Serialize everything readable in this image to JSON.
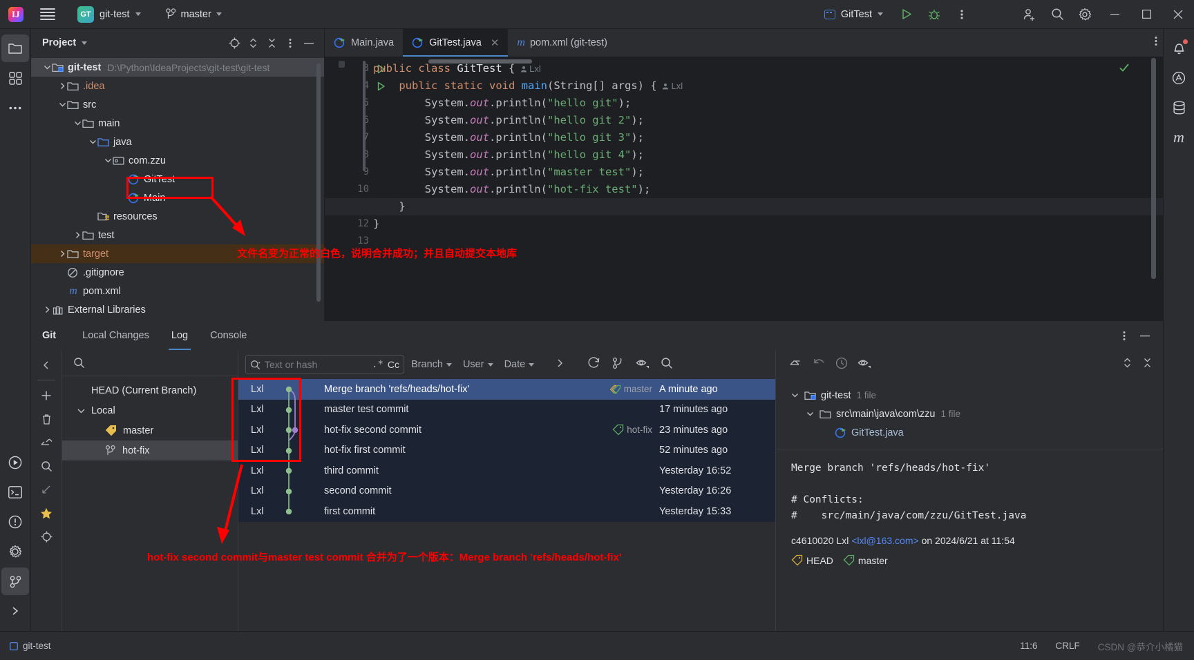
{
  "titlebar": {
    "project_name": "git-test",
    "project_badge": "GT",
    "branch": "master",
    "run_config": "GitTest",
    "icons": [
      "menu-icon",
      "run-icon",
      "debug-icon",
      "more-icon",
      "add-user-icon",
      "search-icon",
      "settings-icon"
    ]
  },
  "project_panel": {
    "title": "Project",
    "tree": [
      {
        "label": "git-test",
        "path": "D:\\Python\\IdeaProjects\\git-test\\git-test",
        "indent": 0,
        "arrow": "down",
        "icon": "module-folder-icon",
        "bold": true,
        "selected": true
      },
      {
        "label": ".idea",
        "indent": 1,
        "arrow": "right",
        "icon": "folder-icon",
        "color": "orange"
      },
      {
        "label": "src",
        "indent": 1,
        "arrow": "down",
        "icon": "folder-icon"
      },
      {
        "label": "main",
        "indent": 2,
        "arrow": "down",
        "icon": "folder-icon"
      },
      {
        "label": "java",
        "indent": 3,
        "arrow": "down",
        "icon": "source-folder-icon"
      },
      {
        "label": "com.zzu",
        "indent": 4,
        "arrow": "down",
        "icon": "package-icon"
      },
      {
        "label": "GitTest",
        "indent": 5,
        "arrow": "none",
        "icon": "java-class-icon",
        "highlighted": true
      },
      {
        "label": "Main",
        "indent": 5,
        "arrow": "none",
        "icon": "java-class-icon"
      },
      {
        "label": "resources",
        "indent": 3,
        "arrow": "none",
        "icon": "resources-folder-icon"
      },
      {
        "label": "test",
        "indent": 2,
        "arrow": "right",
        "icon": "folder-icon"
      },
      {
        "label": "target",
        "indent": 1,
        "arrow": "right",
        "icon": "folder-icon",
        "color": "orange",
        "target": true
      },
      {
        "label": ".gitignore",
        "indent": 1,
        "arrow": "none",
        "icon": "ignore-file-icon"
      },
      {
        "label": "pom.xml",
        "indent": 1,
        "arrow": "none",
        "icon": "maven-icon"
      },
      {
        "label": "External Libraries",
        "indent": 0,
        "arrow": "right",
        "icon": "library-icon"
      }
    ]
  },
  "editor": {
    "tabs": [
      {
        "label": "Main.java",
        "icon": "java-class-icon",
        "active": false,
        "closable": false
      },
      {
        "label": "GitTest.java",
        "icon": "java-class-icon",
        "active": true,
        "closable": true
      },
      {
        "label": "pom.xml (git-test)",
        "icon": "maven-icon",
        "active": false,
        "closable": false
      }
    ],
    "lines": [
      {
        "num": "3",
        "run": true,
        "segments": [
          {
            "t": "public ",
            "c": "kw"
          },
          {
            "t": "class ",
            "c": "kw"
          },
          {
            "t": "GitTest ",
            "c": "cls"
          },
          {
            "t": "{",
            "c": "pn"
          }
        ],
        "hint": "Lxl"
      },
      {
        "num": "4",
        "run": true,
        "segments": [
          {
            "t": "    public ",
            "c": "kw"
          },
          {
            "t": "static ",
            "c": "kw"
          },
          {
            "t": "void ",
            "c": "kw"
          },
          {
            "t": "main",
            "c": "mth"
          },
          {
            "t": "(String[] args) {",
            "c": "pn"
          }
        ],
        "hint": "Lxl"
      },
      {
        "num": "5",
        "run": false,
        "segments": [
          {
            "t": "        System.",
            "c": "pn"
          },
          {
            "t": "out",
            "c": "fld"
          },
          {
            "t": ".println(",
            "c": "pn"
          },
          {
            "t": "\"hello git\"",
            "c": "str"
          },
          {
            "t": ");",
            "c": "pn"
          }
        ]
      },
      {
        "num": "6",
        "run": false,
        "segments": [
          {
            "t": "        System.",
            "c": "pn"
          },
          {
            "t": "out",
            "c": "fld"
          },
          {
            "t": ".println(",
            "c": "pn"
          },
          {
            "t": "\"hello git 2\"",
            "c": "str"
          },
          {
            "t": ");",
            "c": "pn"
          }
        ]
      },
      {
        "num": "7",
        "run": false,
        "segments": [
          {
            "t": "        System.",
            "c": "pn"
          },
          {
            "t": "out",
            "c": "fld"
          },
          {
            "t": ".println(",
            "c": "pn"
          },
          {
            "t": "\"hello git 3\"",
            "c": "str"
          },
          {
            "t": ");",
            "c": "pn"
          }
        ]
      },
      {
        "num": "8",
        "run": false,
        "segments": [
          {
            "t": "        System.",
            "c": "pn"
          },
          {
            "t": "out",
            "c": "fld"
          },
          {
            "t": ".println(",
            "c": "pn"
          },
          {
            "t": "\"hello git 4\"",
            "c": "str"
          },
          {
            "t": ");",
            "c": "pn"
          }
        ]
      },
      {
        "num": "9",
        "run": false,
        "segments": [
          {
            "t": "        System.",
            "c": "pn"
          },
          {
            "t": "out",
            "c": "fld"
          },
          {
            "t": ".println(",
            "c": "pn"
          },
          {
            "t": "\"master test\"",
            "c": "str"
          },
          {
            "t": ");",
            "c": "pn"
          }
        ]
      },
      {
        "num": "10",
        "run": false,
        "segments": [
          {
            "t": "        System.",
            "c": "pn"
          },
          {
            "t": "out",
            "c": "fld"
          },
          {
            "t": ".println(",
            "c": "pn"
          },
          {
            "t": "\"hot-fix test\"",
            "c": "str"
          },
          {
            "t": ");",
            "c": "pn"
          }
        ]
      },
      {
        "num": "11",
        "run": false,
        "segments": [
          {
            "t": "    }",
            "c": "pn"
          }
        ],
        "current": true
      },
      {
        "num": "12",
        "run": false,
        "segments": [
          {
            "t": "}",
            "c": "pn"
          }
        ]
      },
      {
        "num": "13",
        "run": false,
        "segments": [
          {
            "t": "",
            "c": "pn"
          }
        ]
      }
    ]
  },
  "git_panel": {
    "title": "Git",
    "tabs": [
      {
        "label": "Local Changes",
        "active": false
      },
      {
        "label": "Log",
        "active": true
      },
      {
        "label": "Console",
        "active": false
      }
    ],
    "branches": {
      "head_label": "HEAD (Current Branch)",
      "local_label": "Local",
      "items": [
        {
          "label": "master",
          "icon": "tag-icon",
          "selected": false
        },
        {
          "label": "hot-fix",
          "icon": "branch-icon",
          "selected": true
        }
      ]
    },
    "log_toolbar": {
      "search_placeholder": "Text or hash",
      "regex_label": ".*",
      "case_label": "Cc",
      "filters": [
        "Branch",
        "User",
        "Date"
      ]
    },
    "commits": [
      {
        "author": "Lxl",
        "subject": "Merge branch 'refs/heads/hot-fix'",
        "ref": "master",
        "ref_type": "head-master",
        "date": "A minute ago",
        "selected": true
      },
      {
        "author": "Lxl",
        "subject": "master test commit",
        "ref": "",
        "date": "17 minutes ago",
        "selected": false
      },
      {
        "author": "Lxl",
        "subject": "hot-fix second commit",
        "ref": "hot-fix",
        "ref_type": "branch",
        "date": "23 minutes ago",
        "selected": false
      },
      {
        "author": "Lxl",
        "subject": "hot-fix first commit",
        "ref": "",
        "date": "52 minutes ago",
        "selected": false
      },
      {
        "author": "Lxl",
        "subject": "third commit",
        "ref": "",
        "date": "Yesterday 16:52",
        "selected": false
      },
      {
        "author": "Lxl",
        "subject": "second commit",
        "ref": "",
        "date": "Yesterday 16:26",
        "selected": false
      },
      {
        "author": "Lxl",
        "subject": "first commit",
        "ref": "",
        "date": "Yesterday 15:33",
        "selected": false
      }
    ],
    "details": {
      "files": [
        {
          "label": "git-test",
          "count": "1 file",
          "indent": 0,
          "icon": "module-folder-icon"
        },
        {
          "label": "src\\main\\java\\com\\zzu",
          "count": "1 file",
          "indent": 1,
          "icon": "folder-icon"
        },
        {
          "label": "GitTest.java",
          "count": "",
          "indent": 2,
          "icon": "java-class-icon"
        }
      ],
      "message_line1": "Merge branch 'refs/heads/hot-fix'",
      "message_line2": "# Conflicts:",
      "message_line3": "#    src/main/java/com/zzu/GitTest.java",
      "hash": "c4610020",
      "author": "Lxl",
      "email": "<lxl@163.com>",
      "on_text": "on 2024/6/21 at 11:54",
      "refs": [
        "HEAD",
        "master"
      ]
    }
  },
  "statusbar": {
    "project": "git-test",
    "caret": "11:6",
    "line_sep": "CRLF",
    "watermark": "CSDN @恭介小橘猫"
  },
  "annotations": {
    "note1": "文件名变为正常的白色，说明合并成功；并且自动提交本地库",
    "note2": "hot-fix second commit与master test commit 合并为了一个版本：Merge branch 'refs/heads/hot-fix'"
  }
}
